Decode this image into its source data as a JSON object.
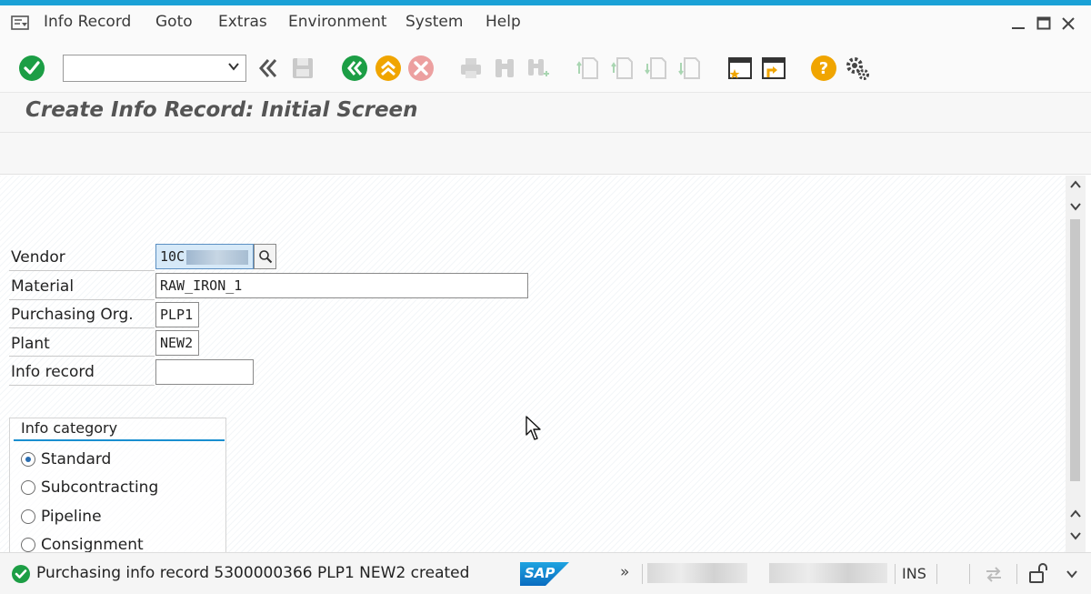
{
  "menubar": {
    "items": [
      "Info Record",
      "Goto",
      "Extras",
      "Environment",
      "System",
      "Help"
    ]
  },
  "toolbar": {
    "command_field_value": "",
    "icons": [
      "enter-icon",
      "back-double-icon",
      "save-icon",
      "back-icon",
      "exit-icon",
      "cancel-icon",
      "print-icon",
      "find-icon",
      "find-next-icon",
      "first-page-icon",
      "previous-page-icon",
      "next-page-icon",
      "last-page-icon",
      "create-session-icon",
      "shortcut-icon",
      "help-icon",
      "settings-icon"
    ]
  },
  "screen": {
    "title": "Create Info Record: Initial Screen"
  },
  "form": {
    "vendor_label": "Vendor",
    "vendor_value": "10C",
    "material_label": "Material",
    "material_value": "RAW_IRON_1",
    "purch_org_label": "Purchasing Org.",
    "purch_org_value": "PLP1",
    "plant_label": "Plant",
    "plant_value": "NEW2",
    "info_record_label": "Info record",
    "info_record_value": ""
  },
  "info_category": {
    "title": "Info category",
    "options": [
      "Standard",
      "Subcontracting",
      "Pipeline",
      "Consignment"
    ],
    "selected": "Standard"
  },
  "status": {
    "message": "Purchasing info record 5300000366 PLP1  NEW2 created",
    "mode": "INS",
    "logo_text": "SAP",
    "more_symbol": "»"
  },
  "colors": {
    "accent": "#1aa1d6",
    "success": "#1c9e45",
    "warning": "#f0a500",
    "cancel": "#d9534f"
  }
}
